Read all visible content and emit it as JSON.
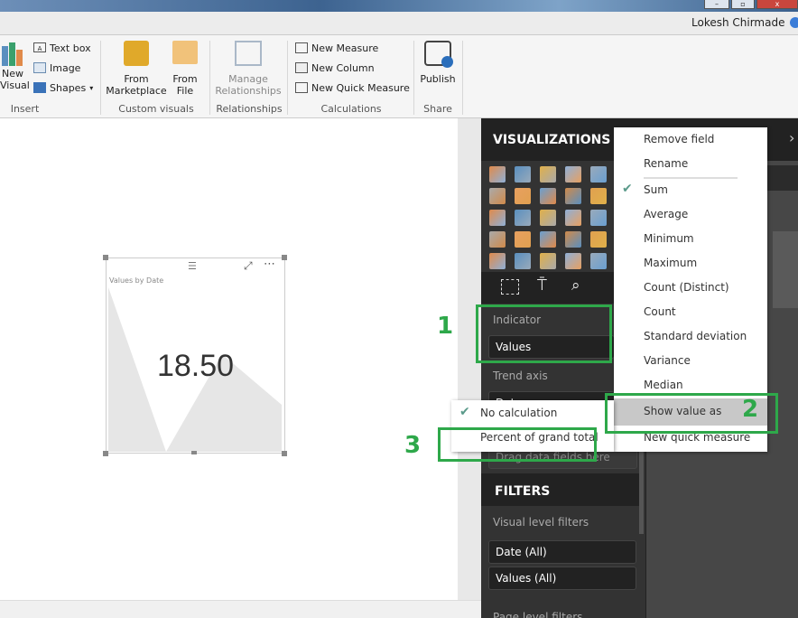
{
  "window": {
    "user": "Lokesh Chirmade",
    "controls": [
      "minimize",
      "restore",
      "close"
    ]
  },
  "ribbon": {
    "groups": [
      {
        "label": "Insert",
        "items": [
          {
            "label": "New Visual",
            "icon": "new-visual-icon"
          },
          {
            "label": "Text box",
            "icon": "textbox-icon"
          },
          {
            "label": "Image",
            "icon": "image-icon"
          },
          {
            "label": "Shapes",
            "icon": "shapes-icon"
          }
        ]
      },
      {
        "label": "Custom visuals",
        "items": [
          {
            "label": "From Marketplace",
            "icon": "marketplace-icon"
          },
          {
            "label": "From File",
            "icon": "folder-icon"
          }
        ]
      },
      {
        "label": "Relationships",
        "items": [
          {
            "label": "Manage Relationships",
            "icon": "relationships-icon",
            "disabled": true
          }
        ]
      },
      {
        "label": "Calculations",
        "items": [
          {
            "label": "New Measure",
            "icon": "calculator-icon"
          },
          {
            "label": "New Column",
            "icon": "table-icon"
          },
          {
            "label": "New Quick Measure",
            "icon": "calculator-icon"
          }
        ]
      },
      {
        "label": "Share",
        "items": [
          {
            "label": "Publish",
            "icon": "publish-icon"
          }
        ]
      }
    ]
  },
  "visual": {
    "title": "Values by Date",
    "value": "18.50",
    "chart_fill": "#e6e6e6"
  },
  "visualizations": {
    "title": "VISUALIZATIONS",
    "indicator_label": "Indicator",
    "indicator_value": "Values",
    "trend_label": "Trend axis",
    "trend_value": "Date",
    "drag_placeholder": "Drag data fields here"
  },
  "filters": {
    "title": "FILTERS",
    "visual_level": "Visual level filters",
    "items": [
      "Date (All)",
      "Values (All)"
    ],
    "page_level": "Page level filters"
  },
  "context_menu": {
    "items": [
      "Remove field",
      "Rename",
      "Sum",
      "Average",
      "Minimum",
      "Maximum",
      "Count (Distinct)",
      "Count",
      "Standard deviation",
      "Variance",
      "Median",
      "Show value as",
      "New quick measure"
    ],
    "checked": "Sum",
    "highlighted": "Show value as"
  },
  "submenu": {
    "items": [
      "No calculation",
      "Percent of grand total"
    ],
    "checked": "No calculation"
  },
  "annotations": {
    "one": "1",
    "two": "2",
    "three": "3",
    "color": "#2ea84a"
  }
}
